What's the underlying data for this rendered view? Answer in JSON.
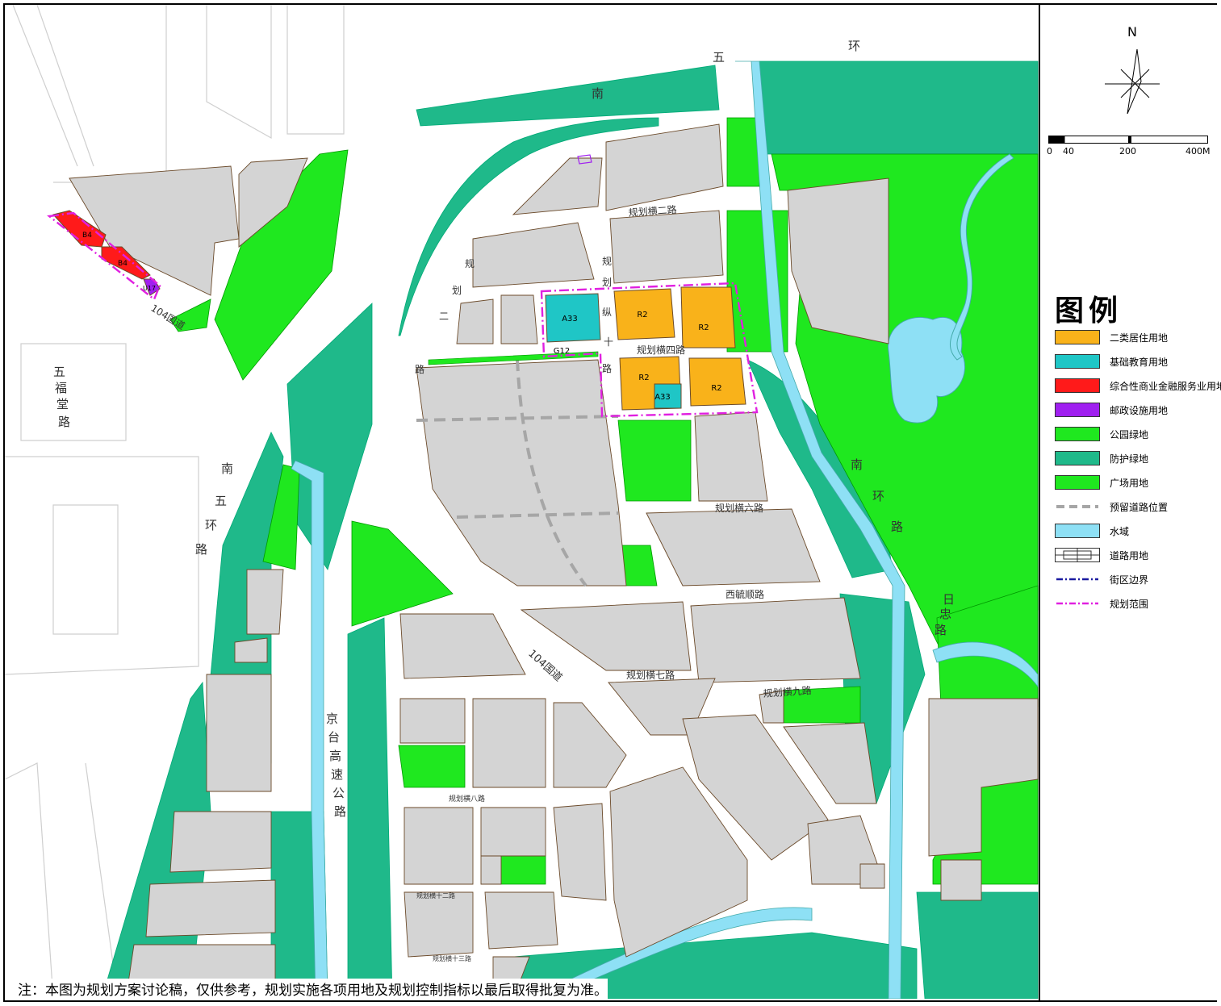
{
  "compass": {
    "north_label": "N"
  },
  "scale": {
    "ticks": [
      "0",
      "40",
      "200",
      "400M"
    ]
  },
  "legend": {
    "title": "图例",
    "items": [
      {
        "label": "二类居住用地",
        "color": "#f9b21a",
        "kind": "fill"
      },
      {
        "label": "基础教育用地",
        "color": "#1fc6c6",
        "kind": "fill"
      },
      {
        "label": "综合性商业金融服务业用地",
        "color": "#ff1a1a",
        "kind": "fill"
      },
      {
        "label": "邮政设施用地",
        "color": "#a020f0",
        "kind": "fill"
      },
      {
        "label": "公园绿地",
        "color": "#1fe81f",
        "kind": "fill"
      },
      {
        "label": "防护绿地",
        "color": "#1fb98a",
        "kind": "fill"
      },
      {
        "label": "广场用地",
        "color": "#1fe81f",
        "kind": "fill"
      },
      {
        "label": "预留道路位置",
        "color": "#b0b0b0",
        "kind": "dashed-road"
      },
      {
        "label": "水域",
        "color": "#8ee0f5",
        "kind": "fill"
      },
      {
        "label": "道路用地",
        "color": "#ffffff",
        "kind": "road"
      },
      {
        "label": "街区边界",
        "color": "#1a1aa0",
        "kind": "dashdot-blue"
      },
      {
        "label": "规划范围",
        "color": "#e020e0",
        "kind": "dashdot-magenta"
      }
    ]
  },
  "road_labels": {
    "nanwuhuan_top": [
      "南",
      "五",
      "环"
    ],
    "hengerlu": "规划横二路",
    "zong_a": [
      "规",
      "划"
    ],
    "zong_b": [
      "规",
      "划",
      "纵",
      "十",
      "路"
    ],
    "heng_si": "规划横四路",
    "er_lu": [
      "二",
      "路"
    ],
    "heng_liu": "规划横六路",
    "xiyulu": "西毓顺路",
    "g104_left": "104国道",
    "g104_mid": "104国道",
    "heng_qi": "规划横七路",
    "heng_jiu": "规划横九路",
    "heng_ba": "规划横八路",
    "jingtai": [
      "京",
      "台",
      "高",
      "速",
      "公",
      "路"
    ],
    "nanwuhuan_left": [
      "南",
      "五",
      "环",
      "路"
    ],
    "wufutang": [
      "五",
      "福",
      "堂",
      "路"
    ],
    "nanhuan_right": [
      "南",
      "环",
      "路"
    ],
    "rizhong": [
      "日",
      "忠",
      "路"
    ],
    "heng_shier": "规划横十二路",
    "heng_shisan": "规划横十三路"
  },
  "plot_labels": {
    "a33_top": "A33",
    "r2_1": "R2",
    "r2_2": "R2",
    "g12": "G12",
    "r2_3": "R2",
    "a33_bottom": "A33",
    "r2_4": "R2",
    "b4_1": "B4",
    "b4_2": "B4",
    "u17": "U17"
  },
  "note": "注：本图为规划方案讨论稿，仅供参考，规划实施各项用地及规划控制指标以最后取得批复为准。"
}
